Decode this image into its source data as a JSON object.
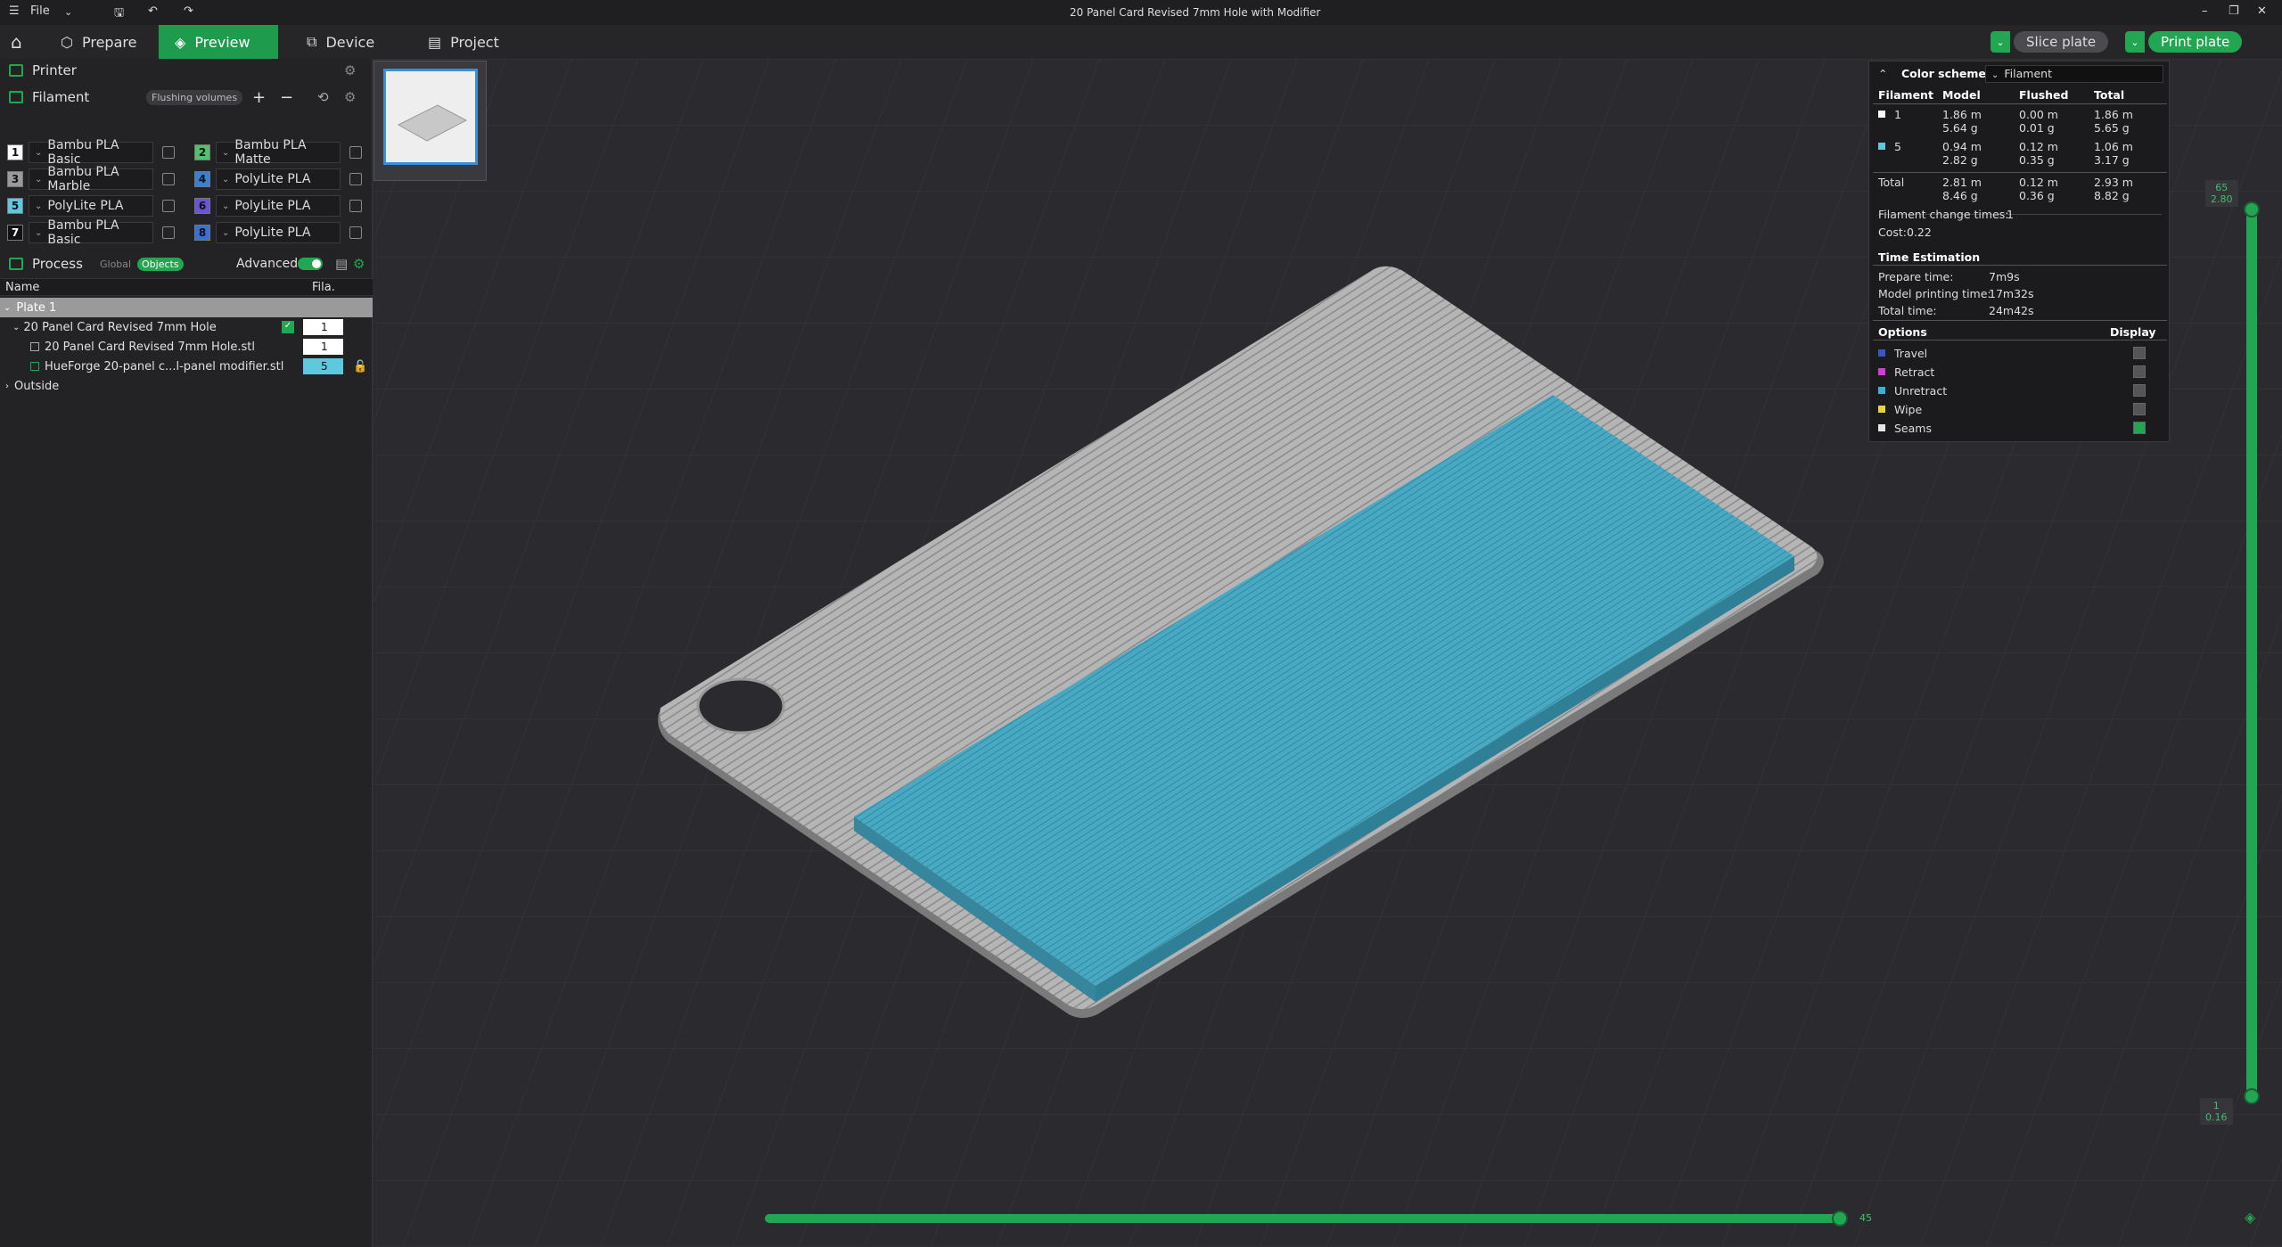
{
  "window": {
    "title": "20 Panel Card  Revised 7mm Hole with Modifier",
    "file_menu": "File"
  },
  "tabs": {
    "prepare": "Prepare",
    "preview": "Preview",
    "device": "Device",
    "project": "Project"
  },
  "actions": {
    "slice": "Slice plate",
    "print": "Print plate"
  },
  "printer": {
    "label": "Printer"
  },
  "filament": {
    "label": "Filament",
    "flushing": "Flushing volumes",
    "slots": [
      {
        "num": "1",
        "name": "Bambu PLA Basic",
        "color": "#ffffff"
      },
      {
        "num": "2",
        "name": "Bambu PLA Matte",
        "color": "#4fc26b"
      },
      {
        "num": "3",
        "name": "Bambu PLA Marble",
        "color": "#9a9a9a"
      },
      {
        "num": "4",
        "name": "PolyLite PLA",
        "color": "#3a7fd6"
      },
      {
        "num": "5",
        "name": "PolyLite PLA",
        "color": "#5ec8e0"
      },
      {
        "num": "6",
        "name": "PolyLite PLA",
        "color": "#6a54d6"
      },
      {
        "num": "7",
        "name": "Bambu PLA Basic",
        "color": "#111111"
      },
      {
        "num": "8",
        "name": "PolyLite PLA",
        "color": "#3a6fd6"
      }
    ]
  },
  "process": {
    "label": "Process",
    "global": "Global",
    "objects": "Objects",
    "advanced": "Advanced"
  },
  "objects": {
    "col_name": "Name",
    "col_fila": "Fila.",
    "plate": "Plate 1",
    "obj": "20 Panel Card  Revised 7mm Hole",
    "obj_fila": "1",
    "part": "20 Panel Card  Revised 7mm Hole.stl",
    "part_fila": "1",
    "modifier": "HueForge 20-panel c...l-panel modifier.stl",
    "modifier_fila": "5",
    "outside": "Outside"
  },
  "legend": {
    "color_scheme": "Color scheme",
    "scheme_value": "Filament",
    "headers": [
      "Filament",
      "Model",
      "Flushed",
      "Total"
    ],
    "rows": [
      {
        "id": "1",
        "color": "#ffffff",
        "model_m": "1.86 m",
        "model_g": "5.64 g",
        "flushed_m": "0.00 m",
        "flushed_g": "0.01 g",
        "total_m": "1.86 m",
        "total_g": "5.65 g"
      },
      {
        "id": "5",
        "color": "#5ec8e0",
        "model_m": "0.94 m",
        "model_g": "2.82 g",
        "flushed_m": "0.12 m",
        "flushed_g": "0.35 g",
        "total_m": "1.06 m",
        "total_g": "3.17 g"
      }
    ],
    "total": {
      "label": "Total",
      "model_m": "2.81 m",
      "model_g": "8.46 g",
      "flushed_m": "0.12 m",
      "flushed_g": "0.36 g",
      "total_m": "2.93 m",
      "total_g": "8.82 g"
    },
    "change_label": "Filament change times:",
    "change_value": "1",
    "cost_label": "Cost:",
    "cost_value": "0.22",
    "time_header": "Time Estimation",
    "prepare_label": "Prepare time:",
    "prepare_value": "7m9s",
    "model_label": "Model printing time:",
    "model_value": "17m32s",
    "total_label": "Total time:",
    "total_value": "24m42s",
    "options_header": "Options",
    "display_header": "Display",
    "options": [
      {
        "name": "Travel",
        "color": "#3a55c8"
      },
      {
        "name": "Retract",
        "color": "#d63ad6"
      },
      {
        "name": "Unretract",
        "color": "#3ab0d6"
      },
      {
        "name": "Wipe",
        "color": "#e6d63a"
      },
      {
        "name": "Seams",
        "color": "#e6e6e6"
      }
    ]
  },
  "slider": {
    "top_layer": "65",
    "top_height": "2.80",
    "bottom_layer": "1",
    "bottom_height": "0.16",
    "h_value": "45"
  }
}
